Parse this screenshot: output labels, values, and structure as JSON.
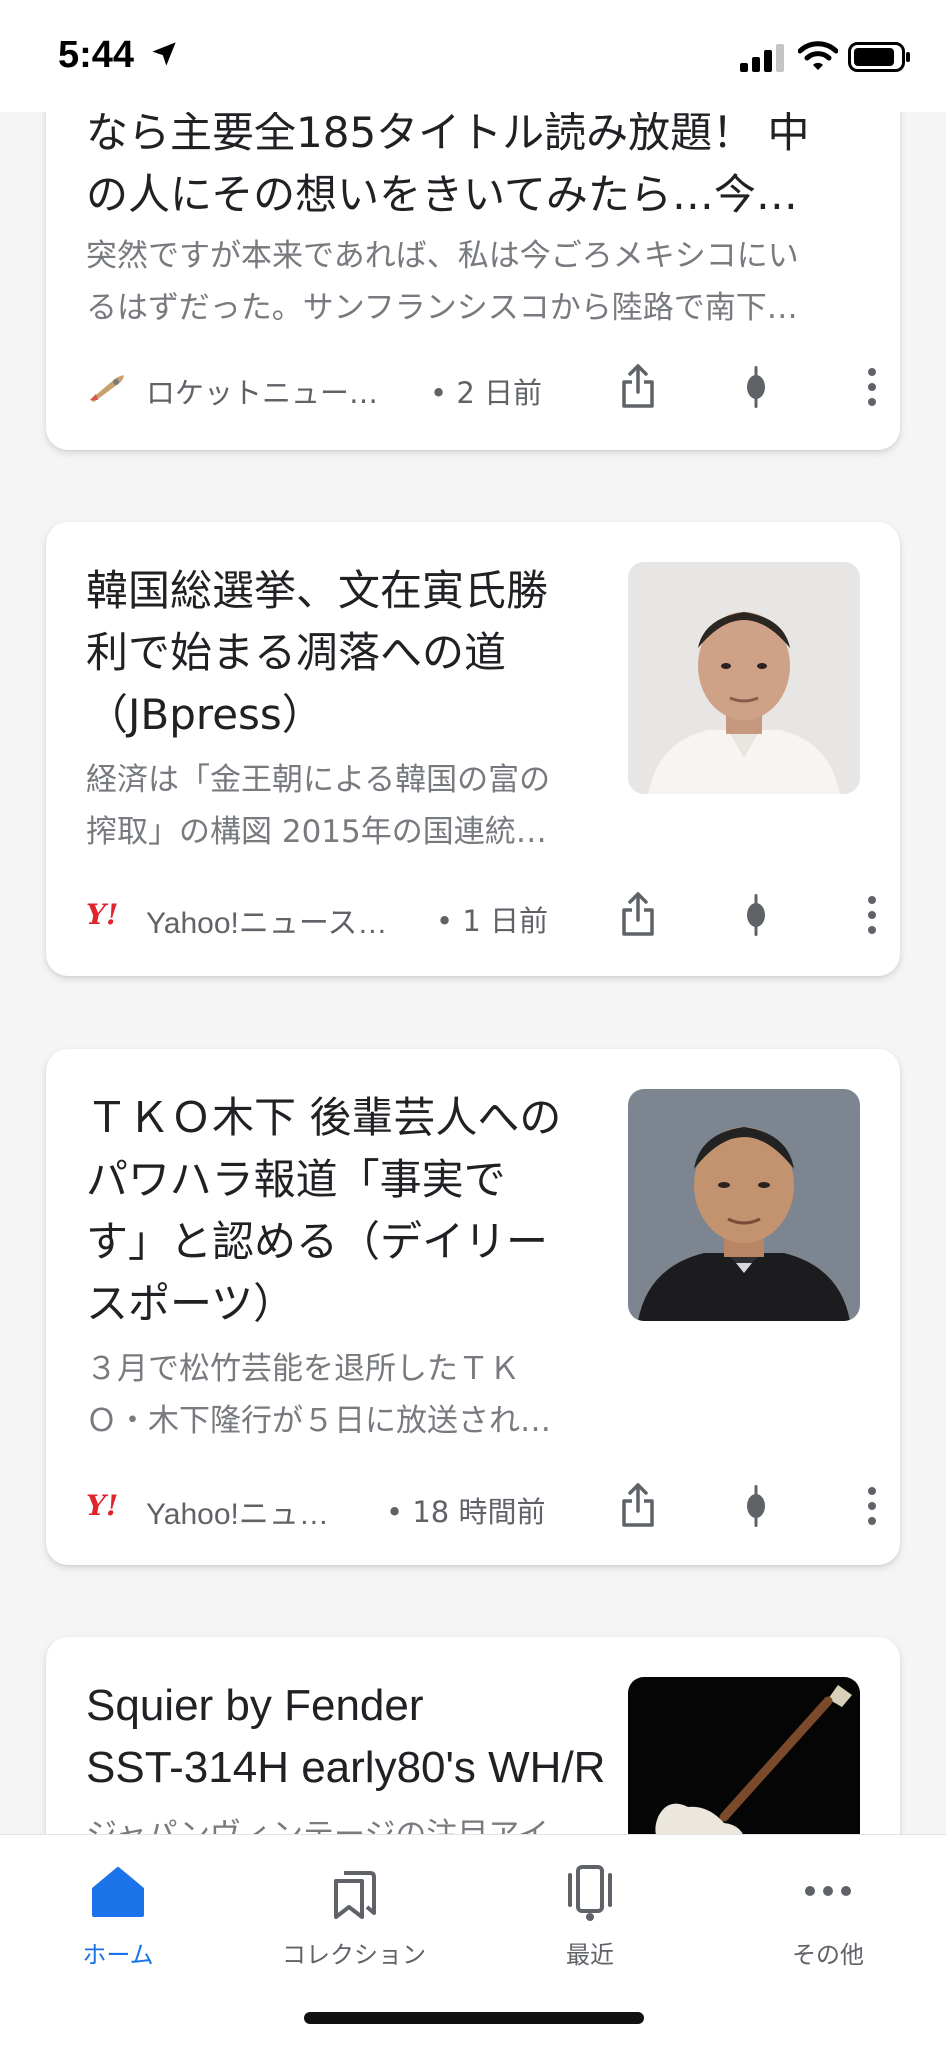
{
  "status_bar": {
    "time": "5:44"
  },
  "articles": [
    {
      "title_line1": "なら主要全185タイトル読み放題！ 中",
      "title_line2": "の人にその想いをきいてみたら…今…",
      "snippet_line1": "突然ですが本来であれば、私は今ごろメキシコにい",
      "snippet_line2": "るはずだった。サンフランシスコから陸路で南下…",
      "source": "ロケットニュー…",
      "time_ago": "• 2 日前"
    },
    {
      "title_line1": "韓国総選挙、文在寅氏勝",
      "title_line2": "利で始まる凋落への道",
      "title_line3": "（JBpress）",
      "snippet_line1": "経済は「金王朝による韓国の富の",
      "snippet_line2": "搾取」の構図 2015年の国連統…",
      "source": "Yahoo!ニュース…",
      "time_ago": "• 1 日前"
    },
    {
      "title_line1": "ＴＫＯ木下 後輩芸人への",
      "title_line2": "パワハラ報道「事実で",
      "title_line3": "す」と認める（デイリー",
      "title_line4": "スポーツ）",
      "snippet_line1": "３月で松竹芸能を退所したＴＫ",
      "snippet_line2": "Ｏ・木下隆行が５日に放送され…",
      "source": "Yahoo!ニュ…",
      "time_ago": "• 18 時間前"
    },
    {
      "title_line1": "Squier by Fender",
      "title_line2": "SST-314H early80's WH/R",
      "snippet_line1": "ジャパンヴィンテージの注目アイ"
    }
  ],
  "nav": {
    "home": "ホーム",
    "collections": "コレクション",
    "recent": "最近",
    "more": "その他"
  },
  "colors": {
    "accent": "#1a73e8",
    "yahoo_red": "#e1242b"
  }
}
